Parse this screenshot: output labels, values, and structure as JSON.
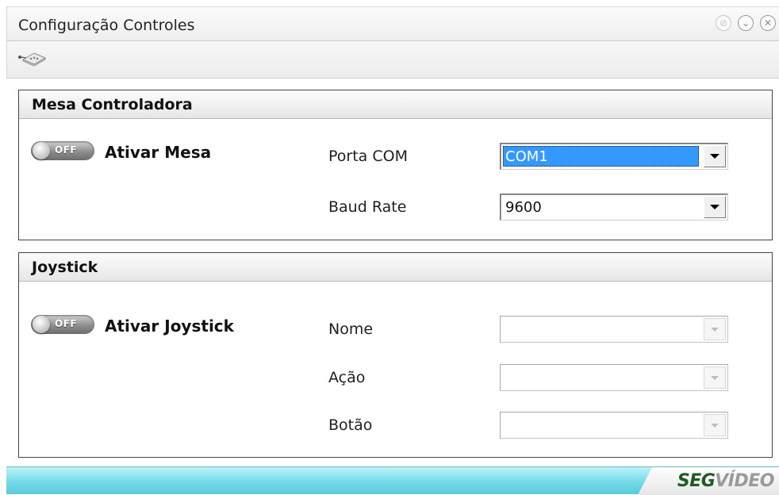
{
  "window": {
    "title": "Configuração Controles",
    "buttons": [
      "pin-icon",
      "minimize-icon",
      "close-icon"
    ]
  },
  "toolbar": {
    "icon": "controller-icon"
  },
  "mesa": {
    "header": "Mesa Controladora",
    "toggle": {
      "state": "OFF",
      "label": "Ativar Mesa"
    },
    "fields": [
      {
        "label": "Porta COM",
        "value": "COM1"
      },
      {
        "label": "Baud Rate",
        "value": "9600"
      }
    ]
  },
  "joystick": {
    "header": "Joystick",
    "toggle": {
      "state": "OFF",
      "label": "Ativar Joystick"
    },
    "fields": [
      {
        "label": "Nome",
        "value": ""
      },
      {
        "label": "Ação",
        "value": ""
      },
      {
        "label": "Botão",
        "value": ""
      }
    ]
  },
  "footer": {
    "brand_a": "SEG",
    "brand_b": "VÍDEO"
  },
  "colors": {
    "selection": "#3399ff",
    "footer": "#70d7e6",
    "brand_green": "#1f5a1f"
  }
}
